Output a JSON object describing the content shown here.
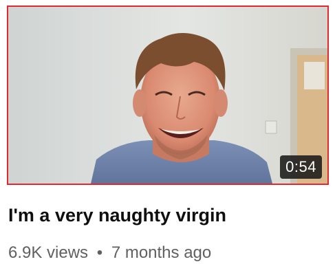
{
  "video": {
    "title": "I'm a very naughty virgin",
    "duration": "0:54",
    "views": "6.9K views",
    "separator": "•",
    "age": "7 months ago"
  },
  "colors": {
    "selection_border": "#e0282e",
    "title_text": "#0f0f0f",
    "meta_text": "#606060",
    "duration_bg": "#141414"
  }
}
